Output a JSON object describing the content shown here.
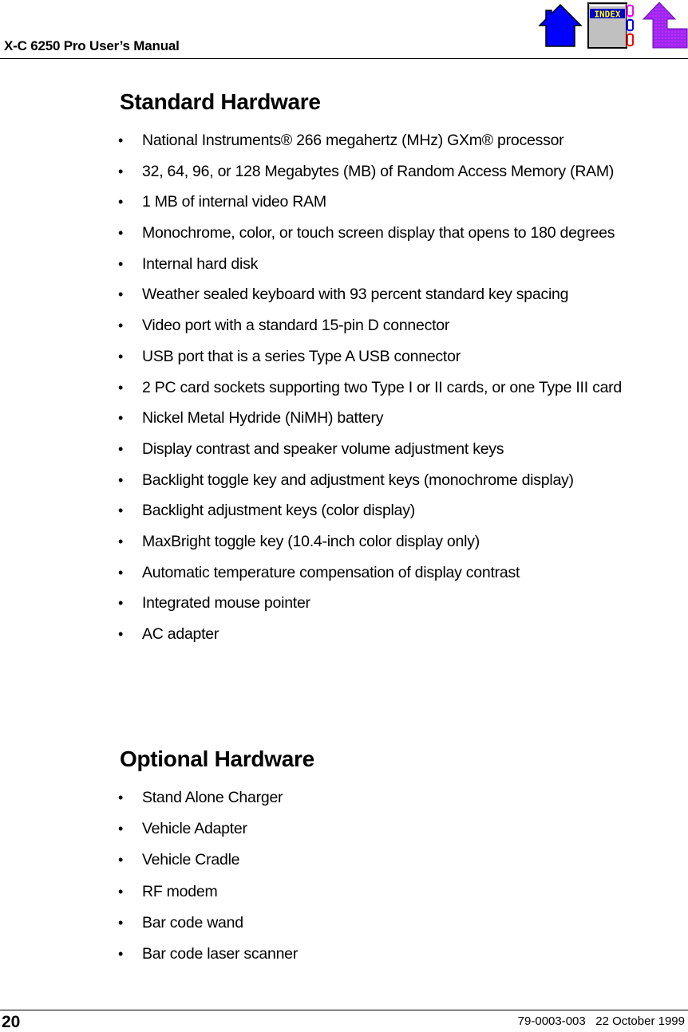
{
  "header": {
    "title": "X-C 6250 Pro User’s Manual",
    "nav_icons": [
      {
        "name": "home-icon",
        "color": "#0000ff"
      },
      {
        "name": "index-icon",
        "label": "INDEX",
        "label_color": "#ffff00",
        "banner_color": "#0000cc",
        "tab_colors": [
          "#ff00ff",
          "#0000ff",
          "#ff0000"
        ]
      },
      {
        "name": "back-arrow-icon",
        "color": "#a020f0"
      }
    ]
  },
  "sections": {
    "standard": {
      "title": "Standard Hardware",
      "items": [
        {
          "text": "National Instruments® 266 megahertz (MHz) GXm® processor"
        },
        {
          "text": "32, 64, 96, or 128 Megabytes (MB) of Random Access Memory (RAM)"
        },
        {
          "text": "1 MB of internal video RAM"
        },
        {
          "text": "Monochrome, color, or touch screen display that opens to 180 degrees"
        },
        {
          "text": "Internal hard disk"
        },
        {
          "text": "Weather sealed keyboard with 93 percent standard key spacing"
        },
        {
          "text": "Video port with a standard 15-pin D connector"
        },
        {
          "text": "USB port that is a series Type A USB connector"
        },
        {
          "text": "2 PC card sockets supporting two Type I or II cards, or one Type III card"
        },
        {
          "text": "Nickel Metal Hydride (NiMH) battery"
        },
        {
          "text": "Display contrast and speaker volume adjustment keys"
        },
        {
          "text": "Backlight toggle key and adjustment keys (monochrome display)"
        },
        {
          "text": "Backlight adjustment keys (color display)"
        },
        {
          "text": "MaxBright toggle key (10.4-inch color display only)"
        },
        {
          "text": "Automatic temperature compensation of display contrast"
        },
        {
          "text": "Integrated mouse pointer"
        },
        {
          "text": "AC adapter"
        }
      ]
    },
    "optional": {
      "title": "Optional Hardware",
      "items": [
        {
          "text": "Stand Alone Charger"
        },
        {
          "text": "Vehicle Adapter"
        },
        {
          "text": "Vehicle Cradle"
        },
        {
          "text": "RF modem"
        },
        {
          "text": "Bar code wand"
        },
        {
          "text": "Bar code laser scanner"
        }
      ]
    }
  },
  "bullet_glyph": "•",
  "footer": {
    "page_number": "20",
    "doc_info": "79-0003-003   22 October 1999"
  }
}
